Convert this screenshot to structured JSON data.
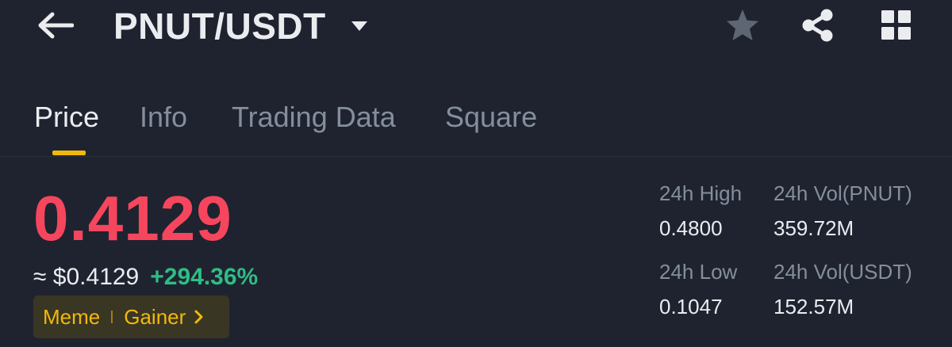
{
  "colors": {
    "background": "#1f2330",
    "primary_text": "#eaecef",
    "muted_text": "#848e9c",
    "accent_yellow": "#f0b90b",
    "price_red": "#f6465d",
    "change_green": "#2ebd85",
    "tag_background": "#3a3624"
  },
  "header": {
    "back_icon": "arrow-left-icon",
    "pair_title": "PNUT/USDT",
    "dropdown_icon": "caret-down-icon",
    "favorite_icon": "star-icon",
    "share_icon": "share-icon",
    "grid_icon": "grid-icon"
  },
  "tabs": [
    {
      "label": "Price",
      "active": true
    },
    {
      "label": "Info",
      "active": false
    },
    {
      "label": "Trading Data",
      "active": false
    },
    {
      "label": "Square",
      "active": false
    }
  ],
  "price": {
    "last": "0.4129",
    "fiat": "≈ $0.4129",
    "change": "+294.36%"
  },
  "tags": {
    "items": [
      "Meme",
      "Gainer"
    ],
    "chevron_icon": "chevron-right-icon"
  },
  "stats": {
    "high_label": "24h High",
    "high_value": "0.4800",
    "vol_base_label": "24h Vol(PNUT)",
    "vol_base_value": "359.72M",
    "low_label": "24h Low",
    "low_value": "0.1047",
    "vol_quote_label": "24h Vol(USDT)",
    "vol_quote_value": "152.57M"
  }
}
